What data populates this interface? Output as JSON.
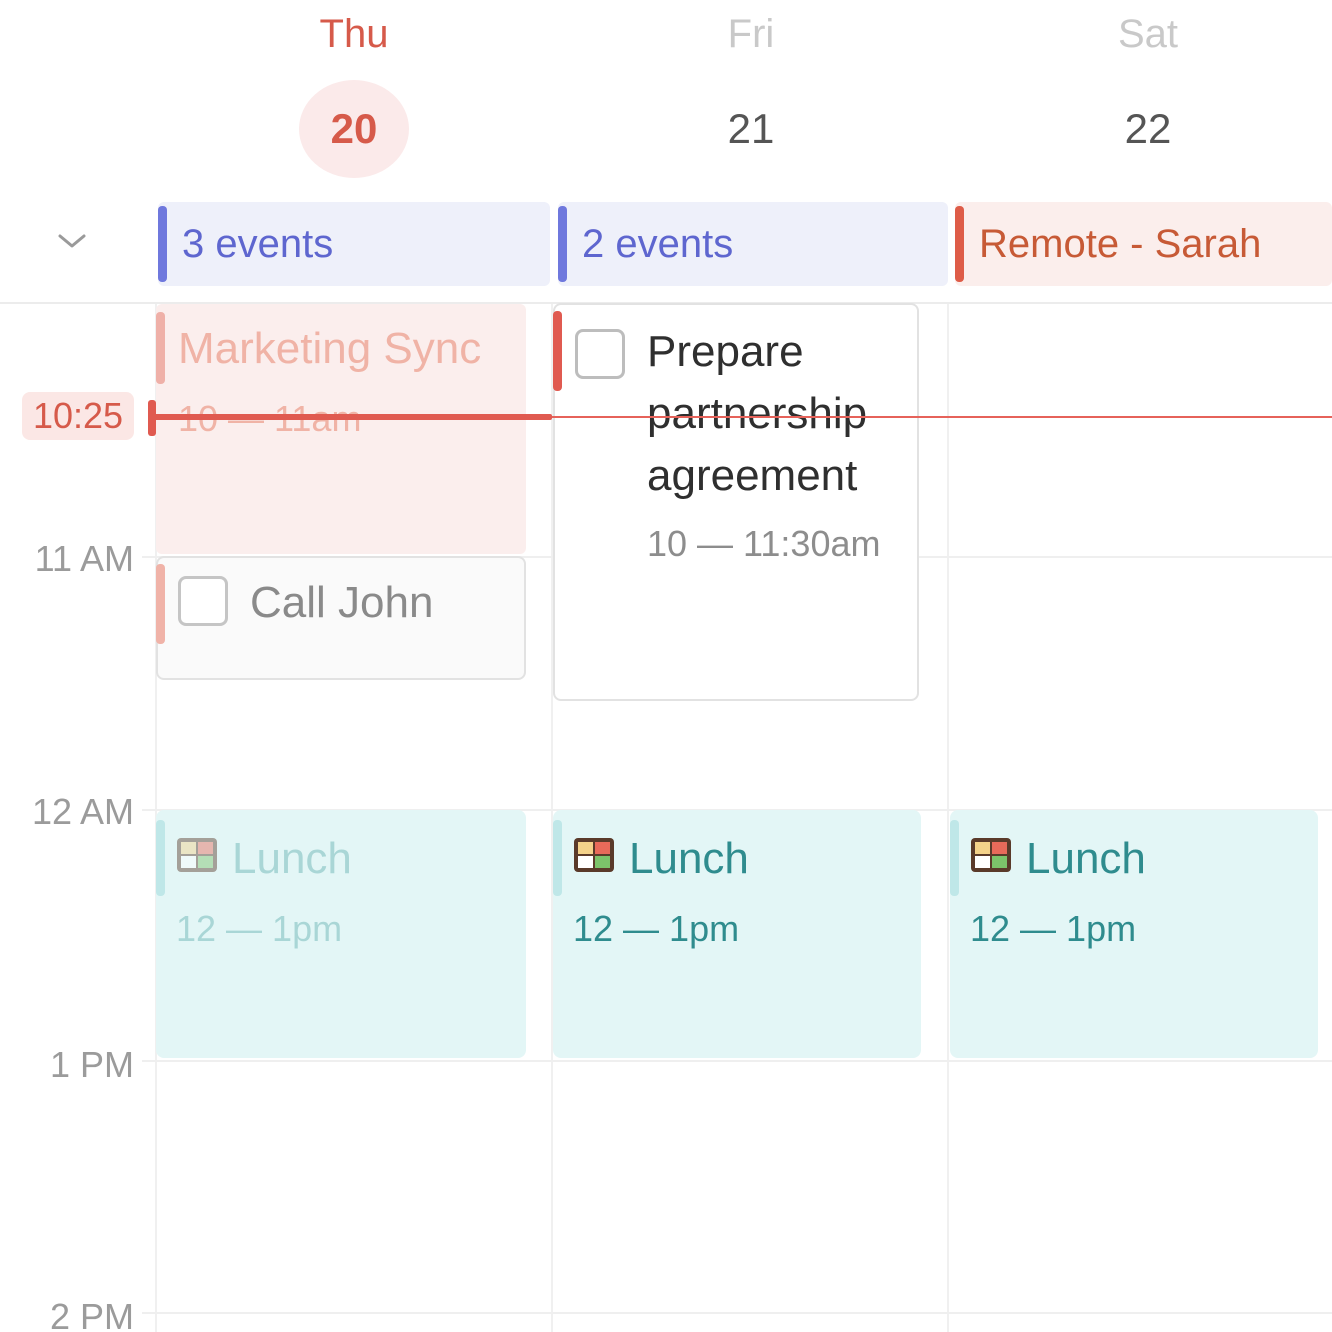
{
  "days": [
    {
      "name": "Thu",
      "number": "20",
      "today": true
    },
    {
      "name": "Fri",
      "number": "21",
      "today": false
    },
    {
      "name": "Sat",
      "number": "22",
      "today": false
    }
  ],
  "allday": {
    "thu": "3 events",
    "fri": "2 events",
    "sat": "Remote - Sarah"
  },
  "hours": [
    "11 AM",
    "12 AM",
    "1 PM",
    "2 PM"
  ],
  "now": {
    "label": "10:25"
  },
  "events": {
    "marketing": {
      "title": "Marketing Sync",
      "time": "10 — 11am"
    },
    "call_john": {
      "title": "Call John",
      "done": false
    },
    "prepare": {
      "title": "Prepare partnership agreement",
      "time": "10 — 11:30am",
      "done": false
    },
    "lunch_thu": {
      "title": "Lunch",
      "time": "12 — 1pm",
      "icon": "bento-box-icon"
    },
    "lunch_fri": {
      "title": "Lunch",
      "time": "12 — 1pm",
      "icon": "bento-box-icon"
    },
    "lunch_sat": {
      "title": "Lunch",
      "time": "12 — 1pm",
      "icon": "bento-box-icon"
    }
  },
  "colors": {
    "today_accent": "#d65a4a",
    "allday_blue": "#6f78dd",
    "allday_red": "#de5c48",
    "lunch_teal": "#2f8c8e",
    "now_line": "#e05a50"
  }
}
